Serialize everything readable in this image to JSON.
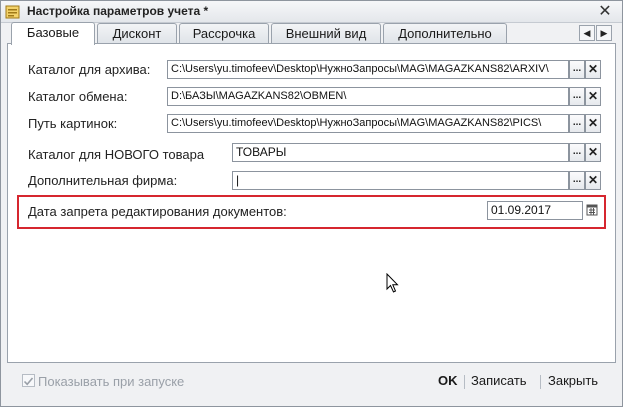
{
  "window": {
    "title": "Настройка параметров учета *"
  },
  "tabs": [
    {
      "label": "Базовые",
      "active": true
    },
    {
      "label": "Дисконт",
      "active": false
    },
    {
      "label": "Рассрочка",
      "active": false
    },
    {
      "label": "Внешний вид",
      "active": false
    },
    {
      "label": "Дополнительно",
      "active": false
    }
  ],
  "fields": {
    "archive_catalog": {
      "label": "Каталог для архива:",
      "value": "C:\\Users\\yu.timofeev\\Desktop\\НужноЗапросы\\MAG\\MAGAZKANS82\\ARXIV\\"
    },
    "exchange_catalog": {
      "label": "Каталог обмена:",
      "value": "D:\\БАЗЫ\\MAGAZKANS82\\OBMEN\\"
    },
    "pictures_path": {
      "label": "Путь картинок:",
      "value": "C:\\Users\\yu.timofeev\\Desktop\\НужноЗапросы\\MAG\\MAGAZKANS82\\PICS\\"
    },
    "new_goods_catalog": {
      "label": "Каталог для НОВОГО товара",
      "value": "ТОВАРЫ"
    },
    "extra_firm": {
      "label": "Дополнительная фирма:",
      "value": "|"
    },
    "edit_lock_date": {
      "label": "Дата запрета редактирования документов:",
      "value": "01.09.2017"
    }
  },
  "buttons": {
    "select": "...",
    "clear": "✕"
  },
  "footer": {
    "show_on_start_label": "Показывать при запуске",
    "show_on_start_checked": true,
    "ok_label": "OK",
    "save_label": "Записать",
    "close_label": "Закрыть"
  },
  "colors": {
    "highlight": "#d6262f"
  }
}
